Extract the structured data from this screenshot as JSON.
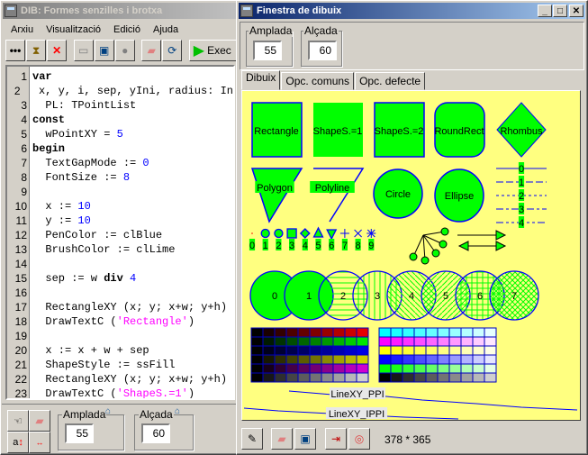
{
  "main_window": {
    "title": "DIB: Formes senzilles i brotxa",
    "menu": [
      "Arxiu",
      "Visualització",
      "Edició",
      "Ajuda"
    ],
    "toolbar": {
      "run_label": "Exec"
    },
    "code_lines": [
      {
        "n": "1",
        "t": [
          [
            "kw",
            "var"
          ]
        ]
      },
      {
        "n": "2",
        "t": [
          [
            "",
            "  x, y, i, sep, yIni, radius: In"
          ]
        ]
      },
      {
        "n": "3",
        "t": [
          [
            "",
            "  PL: TPointList"
          ]
        ]
      },
      {
        "n": "4",
        "t": [
          [
            "kw",
            "const"
          ]
        ]
      },
      {
        "n": "5",
        "t": [
          [
            "",
            "  wPointXY = "
          ],
          [
            "num",
            "5"
          ]
        ]
      },
      {
        "n": "6",
        "t": [
          [
            "kw",
            "begin"
          ]
        ]
      },
      {
        "n": "7",
        "t": [
          [
            "",
            "  TextGapMode := "
          ],
          [
            "num",
            "0"
          ]
        ]
      },
      {
        "n": "8",
        "t": [
          [
            "",
            "  FontSize := "
          ],
          [
            "num",
            "8"
          ]
        ]
      },
      {
        "n": "9",
        "t": []
      },
      {
        "n": "10",
        "t": [
          [
            "",
            "  x := "
          ],
          [
            "num",
            "10"
          ]
        ]
      },
      {
        "n": "11",
        "t": [
          [
            "",
            "  y := "
          ],
          [
            "num",
            "10"
          ]
        ]
      },
      {
        "n": "12",
        "t": [
          [
            "",
            "  PenColor := clBlue"
          ]
        ]
      },
      {
        "n": "13",
        "t": [
          [
            "",
            "  BrushColor := clLime"
          ]
        ]
      },
      {
        "n": "14",
        "t": []
      },
      {
        "n": "15",
        "t": [
          [
            "",
            "  sep := w "
          ],
          [
            "kw",
            "div"
          ],
          [
            "",
            ""
          ],
          [
            "num",
            " 4"
          ]
        ]
      },
      {
        "n": "16",
        "t": []
      },
      {
        "n": "17",
        "t": [
          [
            "",
            "  RectangleXY (x; y; x+w; y+h)"
          ]
        ]
      },
      {
        "n": "18",
        "t": [
          [
            "",
            "  DrawTextC ("
          ],
          [
            "str",
            "'Rectangle'"
          ],
          [
            "",
            ")"
          ]
        ]
      },
      {
        "n": "19",
        "t": []
      },
      {
        "n": "20",
        "t": [
          [
            "",
            "  x := x + w + sep"
          ]
        ]
      },
      {
        "n": "21",
        "t": [
          [
            "",
            "  ShapeStyle := ssFill"
          ]
        ]
      },
      {
        "n": "22",
        "t": [
          [
            "",
            "  RectangleXY (x; y; x+w; y+h)"
          ]
        ]
      },
      {
        "n": "23",
        "t": [
          [
            "",
            "  DrawTextC ("
          ],
          [
            "str",
            "'ShapeS.=1'"
          ],
          [
            "",
            ")"
          ]
        ]
      }
    ],
    "bottom": {
      "width_label": "Amplada",
      "width_value": "55",
      "height_label": "Alçada",
      "height_value": "60"
    }
  },
  "drawing_window": {
    "title": "Finestra de dibuix",
    "width_label": "Amplada",
    "width_value": "55",
    "height_label": "Alçada",
    "height_value": "60",
    "tabs": [
      "Dibuix",
      "Opc. comuns",
      "Opc. defecte"
    ],
    "selected_tab": "Dibuix",
    "canvas": {
      "background": "#ffff80",
      "pen_color": "#0000ff",
      "brush_color": "#00ff00",
      "shapes_row1": [
        "Rectangle",
        "ShapeS.=1",
        "ShapeS.=2",
        "RoundRect",
        "Rhombus"
      ],
      "shapes_row2": [
        "Polygon",
        "Polyline",
        "Circle",
        "Ellipse"
      ],
      "pen_styles": [
        "0",
        "1",
        "2",
        "3",
        "4"
      ],
      "point_styles": [
        "0",
        "1",
        "2",
        "3",
        "4",
        "5",
        "6",
        "7",
        "8",
        "9"
      ],
      "brush_styles": [
        "0",
        "1",
        "2",
        "3",
        "4",
        "5",
        "6",
        "7"
      ],
      "line_labels": [
        "LineXY_PPI",
        "LineXY_IPPI"
      ]
    },
    "status": "378 * 365"
  }
}
